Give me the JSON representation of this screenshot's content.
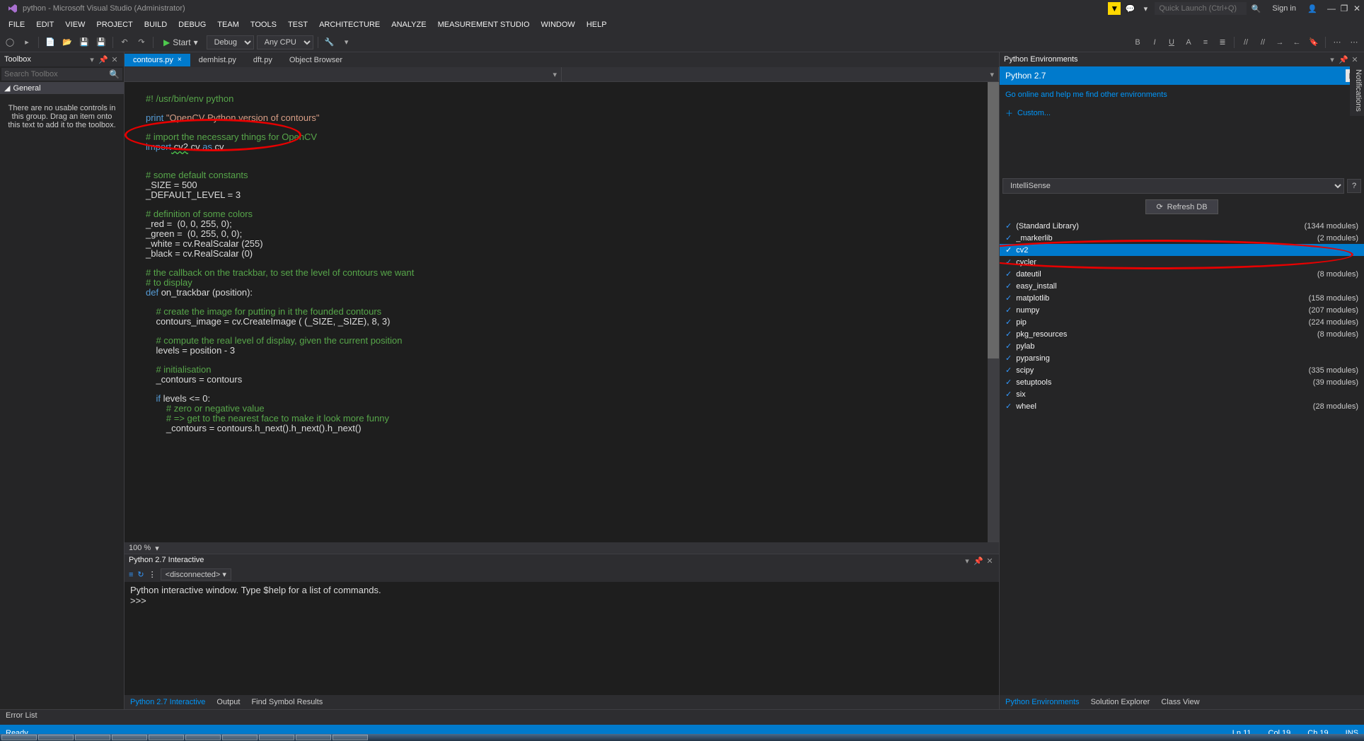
{
  "window": {
    "title": "python - Microsoft Visual Studio (Administrator)"
  },
  "quick_launch": {
    "placeholder": "Quick Launch (Ctrl+Q)"
  },
  "signin": "Sign in",
  "menu": {
    "file": "FILE",
    "edit": "EDIT",
    "view": "VIEW",
    "project": "PROJECT",
    "build": "BUILD",
    "debug": "DEBUG",
    "team": "TEAM",
    "tools": "TOOLS",
    "test": "TEST",
    "architecture": "ARCHITECTURE",
    "analyze": "ANALYZE",
    "measurement": "MEASUREMENT STUDIO",
    "windowm": "WINDOW",
    "help": "HELP"
  },
  "toolbar": {
    "start": "Start",
    "config": "Debug",
    "platform": "Any CPU"
  },
  "toolbox": {
    "title": "Toolbox",
    "search_ph": "Search Toolbox",
    "general": "General",
    "msg": "There are no usable controls in this group. Drag an item onto this text to add it to the toolbox."
  },
  "tabs": [
    {
      "label": "contours.py",
      "active": true
    },
    {
      "label": "demhist.py",
      "active": false
    },
    {
      "label": "dft.py",
      "active": false
    },
    {
      "label": "Object Browser",
      "active": false
    }
  ],
  "zoom": "100 %",
  "interactive": {
    "title": "Python 2.7 Interactive",
    "state": "<disconnected>",
    "line1": "Python interactive window. Type $help for a list of commands.",
    "prompt": ">>>"
  },
  "bottom_tabs": {
    "t1": "Python 2.7 Interactive",
    "t2": "Output",
    "t3": "Find Symbol Results"
  },
  "envs": {
    "title": "Python Environments",
    "current": "Python 2.7",
    "link": "Go online and help me find other environments",
    "custom": "Custom...",
    "dropdown": "IntelliSense",
    "refresh": "Refresh DB"
  },
  "modules": [
    {
      "name": "(Standard Library)",
      "count": "(1344 modules)"
    },
    {
      "name": "_markerlib",
      "count": "(2 modules)"
    },
    {
      "name": "cv2",
      "count": "",
      "selected": true
    },
    {
      "name": "cycler",
      "count": ""
    },
    {
      "name": "dateutil",
      "count": "(8 modules)"
    },
    {
      "name": "easy_install",
      "count": ""
    },
    {
      "name": "matplotlib",
      "count": "(158 modules)"
    },
    {
      "name": "numpy",
      "count": "(207 modules)"
    },
    {
      "name": "pip",
      "count": "(224 modules)"
    },
    {
      "name": "pkg_resources",
      "count": "(8 modules)"
    },
    {
      "name": "pylab",
      "count": ""
    },
    {
      "name": "pyparsing",
      "count": ""
    },
    {
      "name": "scipy",
      "count": "(335 modules)"
    },
    {
      "name": "setuptools",
      "count": "(39 modules)"
    },
    {
      "name": "six",
      "count": ""
    },
    {
      "name": "wheel",
      "count": "(28 modules)"
    }
  ],
  "right_tabs": {
    "t1": "Python Environments",
    "t2": "Solution Explorer",
    "t3": "Class View"
  },
  "error_list": "Error List",
  "status": {
    "ready": "Ready",
    "ln": "Ln 11",
    "col": "Col 19",
    "ch": "Ch 19",
    "ins": "INS"
  },
  "notifications": "Notifications",
  "code": {
    "l1": "#! /usr/bin/env python",
    "l2_a": "print",
    "l2_b": " \"OpenCV Python version of contours\"",
    "l3": "# import the necessary things for OpenCV",
    "l4_a": "import",
    "l4_b": " cv2",
    "l4_c": ".cv ",
    "l4_d": "as",
    "l4_e": " cv",
    "l5": "# some default constants",
    "l6": "_SIZE = 500",
    "l7": "_DEFAULT_LEVEL = 3",
    "l8": "# definition of some colors",
    "l9": "_red =  (0, 0, 255, 0);",
    "l10": "_green =  (0, 255, 0, 0);",
    "l11": "_white = cv.RealScalar (255)",
    "l12": "_black = cv.RealScalar (0)",
    "l13": "# the callback on the trackbar, to set the level of contours we want",
    "l14": "# to display",
    "l15_a": "def",
    "l15_b": " on_trackbar (position):",
    "l16": "    # create the image for putting in it the founded contours",
    "l17": "    contours_image = cv.CreateImage ( (_SIZE, _SIZE), 8, 3)",
    "l18": "    # compute the real level of display, given the current position",
    "l19": "    levels = position - 3",
    "l20": "    # initialisation",
    "l21": "    _contours = contours",
    "l22_a": "    if",
    "l22_b": " levels <= 0:",
    "l23": "        # zero or negative value",
    "l24": "        # => get to the nearest face to make it look more funny",
    "l25": "        _contours = contours.h_next().h_next().h_next()"
  }
}
